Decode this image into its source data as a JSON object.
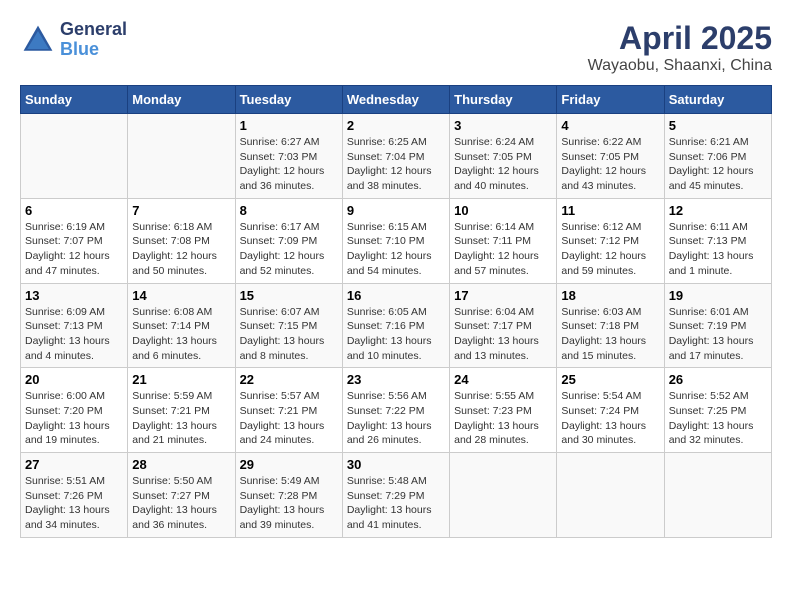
{
  "header": {
    "logo_general": "General",
    "logo_blue": "Blue",
    "month_title": "April 2025",
    "location": "Wayaobu, Shaanxi, China"
  },
  "days_of_week": [
    "Sunday",
    "Monday",
    "Tuesday",
    "Wednesday",
    "Thursday",
    "Friday",
    "Saturday"
  ],
  "weeks": [
    [
      {
        "day": null
      },
      {
        "day": null
      },
      {
        "day": "1",
        "sunrise": "Sunrise: 6:27 AM",
        "sunset": "Sunset: 7:03 PM",
        "daylight": "Daylight: 12 hours and 36 minutes."
      },
      {
        "day": "2",
        "sunrise": "Sunrise: 6:25 AM",
        "sunset": "Sunset: 7:04 PM",
        "daylight": "Daylight: 12 hours and 38 minutes."
      },
      {
        "day": "3",
        "sunrise": "Sunrise: 6:24 AM",
        "sunset": "Sunset: 7:05 PM",
        "daylight": "Daylight: 12 hours and 40 minutes."
      },
      {
        "day": "4",
        "sunrise": "Sunrise: 6:22 AM",
        "sunset": "Sunset: 7:05 PM",
        "daylight": "Daylight: 12 hours and 43 minutes."
      },
      {
        "day": "5",
        "sunrise": "Sunrise: 6:21 AM",
        "sunset": "Sunset: 7:06 PM",
        "daylight": "Daylight: 12 hours and 45 minutes."
      }
    ],
    [
      {
        "day": "6",
        "sunrise": "Sunrise: 6:19 AM",
        "sunset": "Sunset: 7:07 PM",
        "daylight": "Daylight: 12 hours and 47 minutes."
      },
      {
        "day": "7",
        "sunrise": "Sunrise: 6:18 AM",
        "sunset": "Sunset: 7:08 PM",
        "daylight": "Daylight: 12 hours and 50 minutes."
      },
      {
        "day": "8",
        "sunrise": "Sunrise: 6:17 AM",
        "sunset": "Sunset: 7:09 PM",
        "daylight": "Daylight: 12 hours and 52 minutes."
      },
      {
        "day": "9",
        "sunrise": "Sunrise: 6:15 AM",
        "sunset": "Sunset: 7:10 PM",
        "daylight": "Daylight: 12 hours and 54 minutes."
      },
      {
        "day": "10",
        "sunrise": "Sunrise: 6:14 AM",
        "sunset": "Sunset: 7:11 PM",
        "daylight": "Daylight: 12 hours and 57 minutes."
      },
      {
        "day": "11",
        "sunrise": "Sunrise: 6:12 AM",
        "sunset": "Sunset: 7:12 PM",
        "daylight": "Daylight: 12 hours and 59 minutes."
      },
      {
        "day": "12",
        "sunrise": "Sunrise: 6:11 AM",
        "sunset": "Sunset: 7:13 PM",
        "daylight": "Daylight: 13 hours and 1 minute."
      }
    ],
    [
      {
        "day": "13",
        "sunrise": "Sunrise: 6:09 AM",
        "sunset": "Sunset: 7:13 PM",
        "daylight": "Daylight: 13 hours and 4 minutes."
      },
      {
        "day": "14",
        "sunrise": "Sunrise: 6:08 AM",
        "sunset": "Sunset: 7:14 PM",
        "daylight": "Daylight: 13 hours and 6 minutes."
      },
      {
        "day": "15",
        "sunrise": "Sunrise: 6:07 AM",
        "sunset": "Sunset: 7:15 PM",
        "daylight": "Daylight: 13 hours and 8 minutes."
      },
      {
        "day": "16",
        "sunrise": "Sunrise: 6:05 AM",
        "sunset": "Sunset: 7:16 PM",
        "daylight": "Daylight: 13 hours and 10 minutes."
      },
      {
        "day": "17",
        "sunrise": "Sunrise: 6:04 AM",
        "sunset": "Sunset: 7:17 PM",
        "daylight": "Daylight: 13 hours and 13 minutes."
      },
      {
        "day": "18",
        "sunrise": "Sunrise: 6:03 AM",
        "sunset": "Sunset: 7:18 PM",
        "daylight": "Daylight: 13 hours and 15 minutes."
      },
      {
        "day": "19",
        "sunrise": "Sunrise: 6:01 AM",
        "sunset": "Sunset: 7:19 PM",
        "daylight": "Daylight: 13 hours and 17 minutes."
      }
    ],
    [
      {
        "day": "20",
        "sunrise": "Sunrise: 6:00 AM",
        "sunset": "Sunset: 7:20 PM",
        "daylight": "Daylight: 13 hours and 19 minutes."
      },
      {
        "day": "21",
        "sunrise": "Sunrise: 5:59 AM",
        "sunset": "Sunset: 7:21 PM",
        "daylight": "Daylight: 13 hours and 21 minutes."
      },
      {
        "day": "22",
        "sunrise": "Sunrise: 5:57 AM",
        "sunset": "Sunset: 7:21 PM",
        "daylight": "Daylight: 13 hours and 24 minutes."
      },
      {
        "day": "23",
        "sunrise": "Sunrise: 5:56 AM",
        "sunset": "Sunset: 7:22 PM",
        "daylight": "Daylight: 13 hours and 26 minutes."
      },
      {
        "day": "24",
        "sunrise": "Sunrise: 5:55 AM",
        "sunset": "Sunset: 7:23 PM",
        "daylight": "Daylight: 13 hours and 28 minutes."
      },
      {
        "day": "25",
        "sunrise": "Sunrise: 5:54 AM",
        "sunset": "Sunset: 7:24 PM",
        "daylight": "Daylight: 13 hours and 30 minutes."
      },
      {
        "day": "26",
        "sunrise": "Sunrise: 5:52 AM",
        "sunset": "Sunset: 7:25 PM",
        "daylight": "Daylight: 13 hours and 32 minutes."
      }
    ],
    [
      {
        "day": "27",
        "sunrise": "Sunrise: 5:51 AM",
        "sunset": "Sunset: 7:26 PM",
        "daylight": "Daylight: 13 hours and 34 minutes."
      },
      {
        "day": "28",
        "sunrise": "Sunrise: 5:50 AM",
        "sunset": "Sunset: 7:27 PM",
        "daylight": "Daylight: 13 hours and 36 minutes."
      },
      {
        "day": "29",
        "sunrise": "Sunrise: 5:49 AM",
        "sunset": "Sunset: 7:28 PM",
        "daylight": "Daylight: 13 hours and 39 minutes."
      },
      {
        "day": "30",
        "sunrise": "Sunrise: 5:48 AM",
        "sunset": "Sunset: 7:29 PM",
        "daylight": "Daylight: 13 hours and 41 minutes."
      },
      {
        "day": null
      },
      {
        "day": null
      },
      {
        "day": null
      }
    ]
  ]
}
